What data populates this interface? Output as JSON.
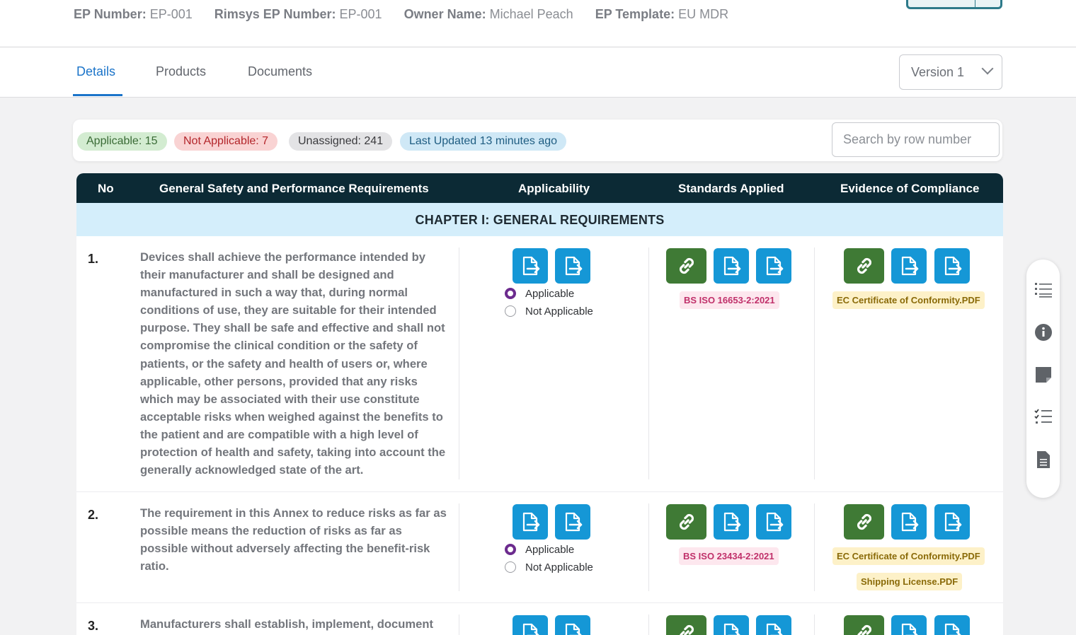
{
  "header": {
    "fields": [
      {
        "label": "EP Number:",
        "value": "EP-001"
      },
      {
        "label": "Rimsys EP Number:",
        "value": "EP-001"
      },
      {
        "label": "Owner Name:",
        "value": "Michael Peach"
      },
      {
        "label": "EP Template:",
        "value": "EU MDR"
      }
    ]
  },
  "tabs": [
    "Details",
    "Products",
    "Documents"
  ],
  "version": "Version 1",
  "status": {
    "applicable": "Applicable: 15",
    "not_applicable": "Not Applicable: 7",
    "unassigned": "Unassigned: 241",
    "last_updated": "Last Updated 13 minutes ago",
    "search_placeholder": "Search by row number"
  },
  "table": {
    "columns": [
      "No",
      "General Safety and Performance Requirements",
      "Applicability",
      "Standards Applied",
      "Evidence of Compliance"
    ],
    "chapter": "CHAPTER I: GENERAL REQUIREMENTS",
    "options": {
      "applicable": "Applicable",
      "not_applicable": "Not Applicable"
    },
    "rows": [
      {
        "no": "1.",
        "text": "Devices shall achieve the performance intended by their manufacturer and shall be designed and manufactured in such a way that, during normal conditions of use, they are suitable for their intended purpose. They shall be safe and effective and shall not compromise the clinical condition or the safety of patients, or the safety and health of users or, where applicable, other persons, provided that any risks which may be associated with their use constitute acceptable risks when weighed against the benefits to the patient and are compatible with a high level of protection of health and safety, taking into account the generally acknowledged state of the art.",
        "selected": "applicable",
        "standards": [
          "BS ISO 16653-2:2021"
        ],
        "evidence": [
          "EC Certificate of Conformity.PDF"
        ]
      },
      {
        "no": "2.",
        "text": "The requirement in this Annex to reduce risks as far as possible means the reduction of risks as far as possible without adversely affecting the benefit-risk ratio.",
        "selected": "applicable",
        "standards": [
          "BS ISO 23434-2:2021"
        ],
        "evidence": [
          "EC Certificate of Conformity.PDF",
          "Shipping License.PDF"
        ]
      },
      {
        "no": "3.",
        "text": "Manufacturers shall establish, implement, document"
      }
    ]
  },
  "side_panel_icons": [
    "list-icon",
    "info-icon",
    "note-icon",
    "checklist-icon",
    "document-icon"
  ],
  "colors": {
    "accent": "#1b74c9",
    "header_dark": "#0c2a35",
    "chapter_bg": "#d4eefb",
    "icon_blue": "#1597d6",
    "icon_green": "#3f7a35",
    "radio_selected": "#6c2b8e"
  }
}
